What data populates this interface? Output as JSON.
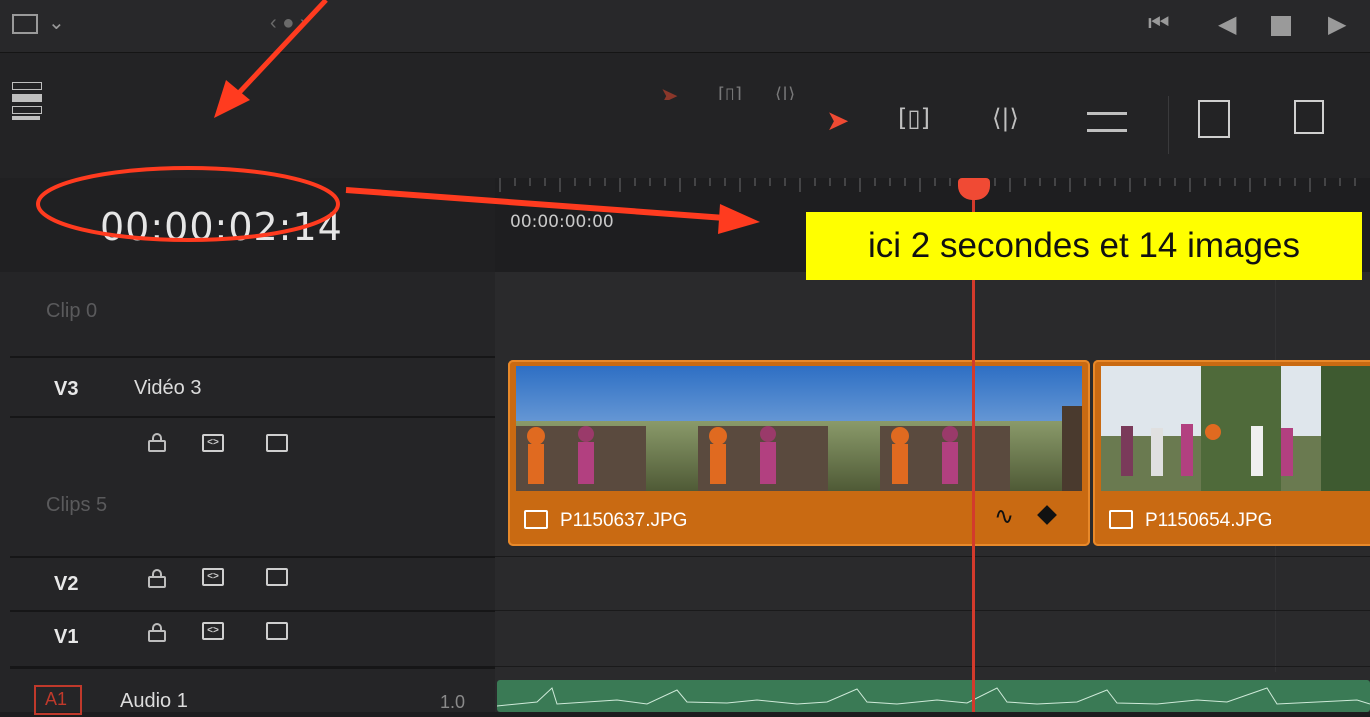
{
  "timecode": "00:00:02:14",
  "ruler": {
    "start_label": "00:00:00:00"
  },
  "annotation": {
    "note": "ici 2 secondes et 14 images",
    "color": "#ff3b1f"
  },
  "tracks": {
    "v3": {
      "id": "V3",
      "name": "Vidéo 3",
      "group_above": "Clip 0",
      "group_below": "Clips 5"
    },
    "v2": {
      "id": "V2"
    },
    "v1": {
      "id": "V1"
    },
    "a1": {
      "id": "A1",
      "name": "Audio 1",
      "level": "1.0"
    }
  },
  "clips": [
    {
      "name": "P1150637.JPG",
      "color": "#c96a12"
    },
    {
      "name": "P1150654.JPG",
      "color": "#c96a12"
    }
  ],
  "playhead": {
    "color": "#d33a2c"
  },
  "icons": [
    "crop-icon",
    "chevron-down-icon",
    "skip-back-icon",
    "step-back-icon",
    "stop-icon",
    "play-icon",
    "layout-icon",
    "select-arrow-icon",
    "trim-icon",
    "dynamic-trim-icon",
    "blade-icon",
    "insert-icon",
    "overwrite-icon",
    "lock-icon",
    "auto-select-icon",
    "track-toggle-icon",
    "image-icon",
    "curve-icon",
    "keyframe-icon"
  ]
}
